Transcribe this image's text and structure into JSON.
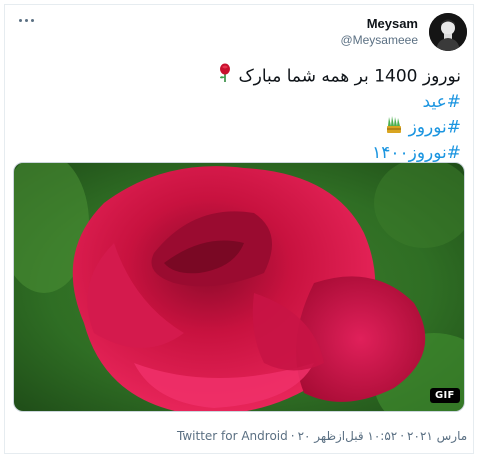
{
  "author": {
    "display_name": "Meysam",
    "handle": "@Meysameee"
  },
  "tweet": {
    "line1": "نوروز 1400 بر همه شما مبارک",
    "hashtag1": "#عید",
    "hashtag2": "#نوروز",
    "hashtag3": "#نوروز۱۴۰۰"
  },
  "media": {
    "badge": "GIF"
  },
  "meta": {
    "source": "Twitter for Android",
    "separator": "·",
    "date": "۲۰ مارس ۲۰۲۱",
    "time": "۱۰:۵۲ قبل‌ازظهر"
  },
  "colors": {
    "link": "#1b95e0",
    "secondary_text": "#5b7083",
    "border": "#ccd6dd"
  }
}
